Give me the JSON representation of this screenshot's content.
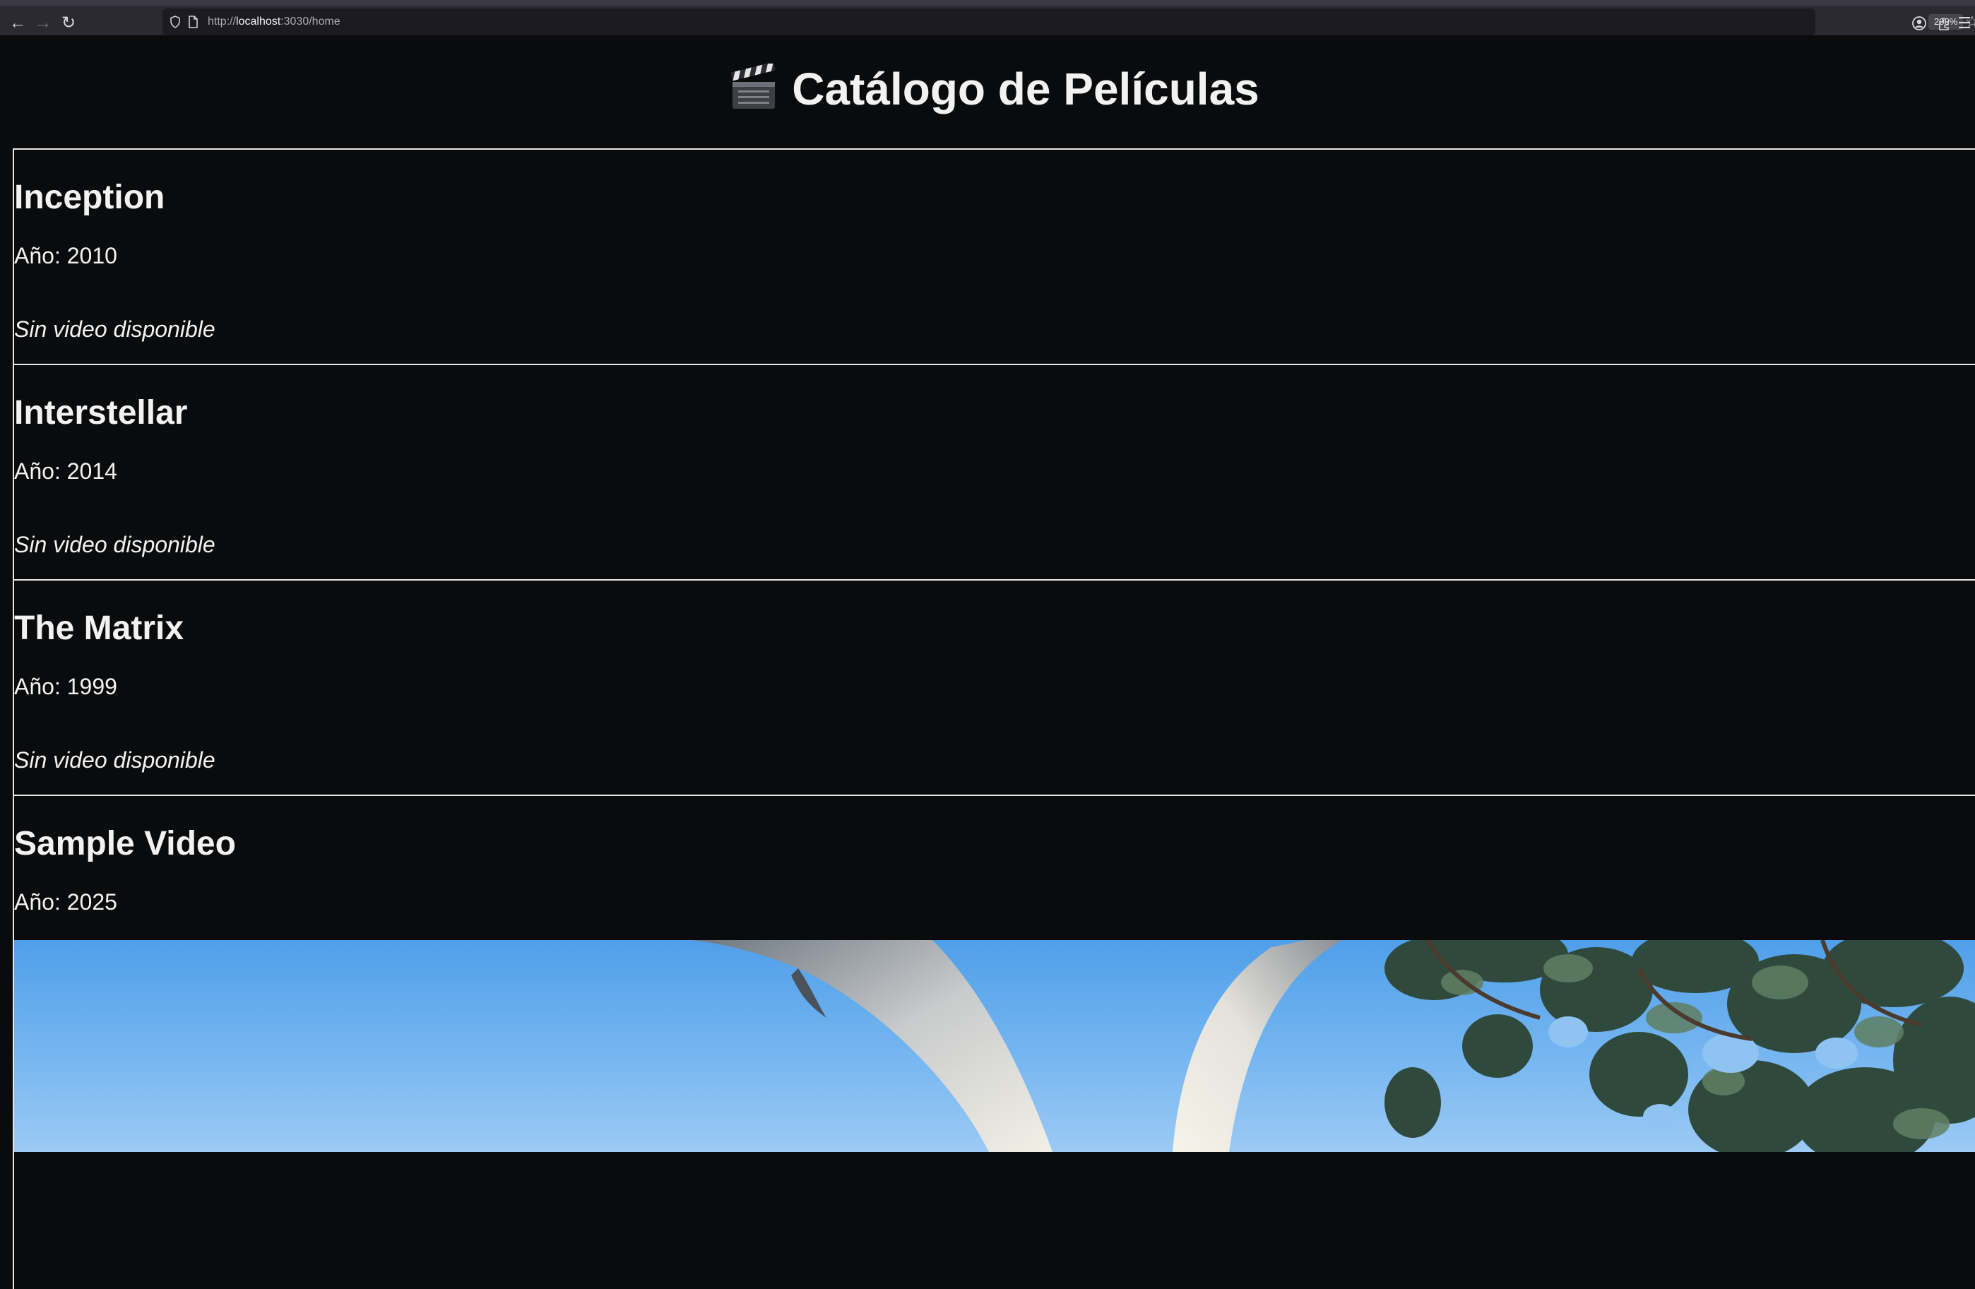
{
  "browser": {
    "url_scheme": "http://",
    "url_host": "localhost",
    "url_path": ":3030/home",
    "zoom": "200%"
  },
  "page": {
    "title": "Catálogo de Películas",
    "title_icon": "clapper-board-icon"
  },
  "movies": [
    {
      "title": "Inception",
      "year": "Año: 2010",
      "no_video": "Sin video disponible"
    },
    {
      "title": "Interstellar",
      "year": "Año: 2014",
      "no_video": "Sin video disponible"
    },
    {
      "title": "The Matrix",
      "year": "Año: 1999",
      "no_video": "Sin video disponible"
    },
    {
      "title": "Sample Video",
      "year": "Año: 2025",
      "has_video": true
    }
  ],
  "colors": {
    "page_background": "#0a0b0c",
    "text": "#f2f2f2",
    "card_border": "#e8e8e8",
    "chrome_background": "#2b2a33",
    "url_field": "#1c1b22",
    "video_sky": "#79b8f2"
  }
}
